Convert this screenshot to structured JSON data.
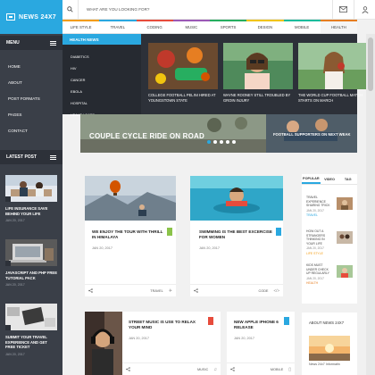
{
  "logo": {
    "text": "NEWS 24X7"
  },
  "sidebar": {
    "menu_label": "MENU",
    "items": [
      {
        "label": "HOME"
      },
      {
        "label": "ABOUT"
      },
      {
        "label": "POST FORMATS"
      },
      {
        "label": "PAGES"
      },
      {
        "label": "CONTACT"
      }
    ],
    "latest_label": "LATEST POST",
    "latest": [
      {
        "title": "LIFE INSURANCE SAVE BEHIND YOUR LIFE",
        "date": "JAN 20, 2017"
      },
      {
        "title": "JAVASCRIPT AND PHP FREE TUTORIAL PACK",
        "date": "JAN 20, 2017"
      },
      {
        "title": "SUBMIT YOUR TRAVEL EXPERIENCE AND GET FREE TICKET",
        "date": "JAN 20, 2017"
      }
    ]
  },
  "search": {
    "placeholder": "WHAT ARE YOU LOOKING FOR?"
  },
  "categories": [
    {
      "label": "LIFE STYLE",
      "color": "#f39c12"
    },
    {
      "label": "TRAVEL",
      "color": "#2aa8e0"
    },
    {
      "label": "CODING",
      "color": "#e74c3c"
    },
    {
      "label": "MUSIC",
      "color": "#9b59b6"
    },
    {
      "label": "SPORTS",
      "color": "#27ae60"
    },
    {
      "label": "DESIGN",
      "color": "#f1c40f"
    },
    {
      "label": "MOBILE",
      "color": "#1abc9c"
    },
    {
      "label": "HEALTH",
      "color": "#e67e22"
    }
  ],
  "mega": {
    "highlight": "HEALTH NEWS",
    "sub": [
      {
        "label": "DIABETICS"
      },
      {
        "label": "HIV"
      },
      {
        "label": "CANCER"
      },
      {
        "label": "EBOLA"
      },
      {
        "label": "HOSPITAL"
      },
      {
        "label": "HEALTH CARE"
      }
    ],
    "cards": [
      {
        "title": "COLLEGE FOOTBALL PELINI HIRED AT YOUNGSTOWN STATE"
      },
      {
        "title": "WAYNE ROONEY STILL TROUBLED BY GROIN INJURY"
      },
      {
        "title": "THE WORLD CUP FOOTBALL MATCH STARTS ON MARCH"
      }
    ]
  },
  "hero": {
    "title": "COUPLE CYCLE RIDE ON ROAD",
    "right_title": "FOOTBALL SUPPORTERS ON NEXT WEAK"
  },
  "posts": [
    {
      "title": "WE ENJOY THE TOUR WITH THRILL IN HIMALAYA",
      "date": "JAN 20, 2017",
      "category": "TRAVEL",
      "flag_color": "#8bc34a"
    },
    {
      "title": "SWIMMING IS THE BEST EXCERCISE FOR WOMEN",
      "date": "JAN 20, 2017",
      "category": "CODE",
      "flag_color": "#2aa8e0"
    },
    {
      "title": "STREET MUSIC IS USE TO RELAX YOUR MIND",
      "date": "JAN 20, 2017",
      "category": "MUSIC",
      "flag_color": "#e74c3c"
    },
    {
      "title": "NEW APPLE IPHONE 6 RELEASE",
      "date": "JAN 20, 2017",
      "category": "MOBILE",
      "flag_color": "#2aa8e0"
    }
  ],
  "widget": {
    "tabs": [
      {
        "label": "POPULAR"
      },
      {
        "label": "VIDEO"
      },
      {
        "label": "TAG"
      }
    ],
    "items": [
      {
        "title": "TRAVEL EXPERIENCE SHARING TRICK",
        "date": "JAN 20, 2017",
        "category": "TRAVEL"
      },
      {
        "title": "HOW OUT A STRANGERS THINKING IN YOUR LIFE",
        "date": "JAN 20, 2017",
        "category": "LIFE STYLE"
      },
      {
        "title": "KIDS MUST UNDER CHECK UP REGULARLY",
        "date": "JAN 20, 2017",
        "category": "HEALTH"
      }
    ]
  },
  "about": {
    "heading": "ABOUT NEWS 24X7",
    "subtitle": "News 24x7 Informatin"
  }
}
